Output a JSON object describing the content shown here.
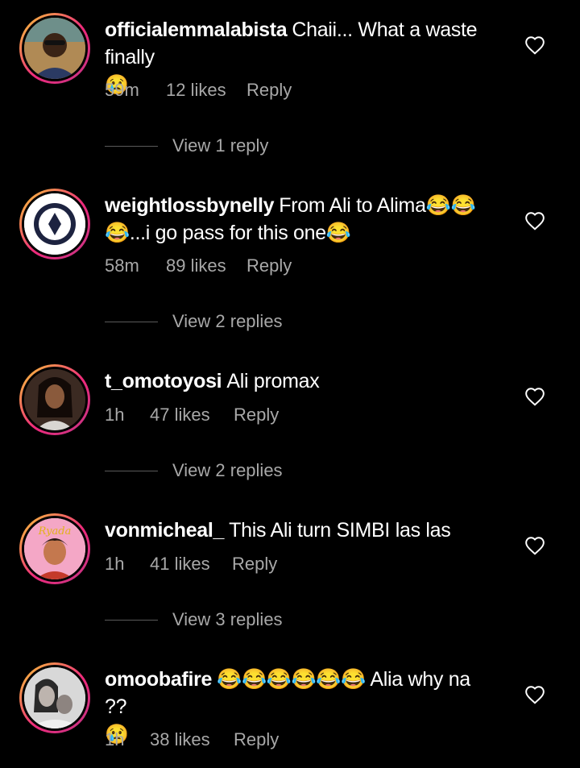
{
  "comments": [
    {
      "username": "officialemmalabista",
      "text": "Chaii... What a waste finally",
      "emoji_after": "😢",
      "time": "59m",
      "likes": "12 likes",
      "reply": "Reply",
      "view_replies": "View 1 reply"
    },
    {
      "username": "weightlossbynelly",
      "text": "From Ali to Alima😂😂😂...i go pass for this one😂",
      "time": "58m",
      "likes": "89 likes",
      "reply": "Reply",
      "view_replies": "View 2 replies"
    },
    {
      "username": "t_omotoyosi",
      "text": "Ali promax",
      "time": "1h",
      "likes": "47 likes",
      "reply": "Reply",
      "view_replies": "View 2 replies"
    },
    {
      "username": "vonmicheal_",
      "text": "This Ali turn SIMBI las las",
      "time": "1h",
      "likes": "41 likes",
      "reply": "Reply",
      "view_replies": "View 3 replies"
    },
    {
      "username": "omoobafire",
      "text": "😂😂😂😂😂😂 Alia why na ??",
      "emoji_after": "😢",
      "time": "1h",
      "likes": "38 likes",
      "reply": "Reply"
    }
  ],
  "avatar_labels": {
    "vonmicheal": "Ryada"
  },
  "colors": {
    "background": "#000000",
    "text": "#ffffff",
    "meta": "#a8a8a8",
    "story_ring_start": "#f9ce34",
    "story_ring_end": "#c13584"
  },
  "icons": {
    "like": "heart-outline-icon"
  }
}
